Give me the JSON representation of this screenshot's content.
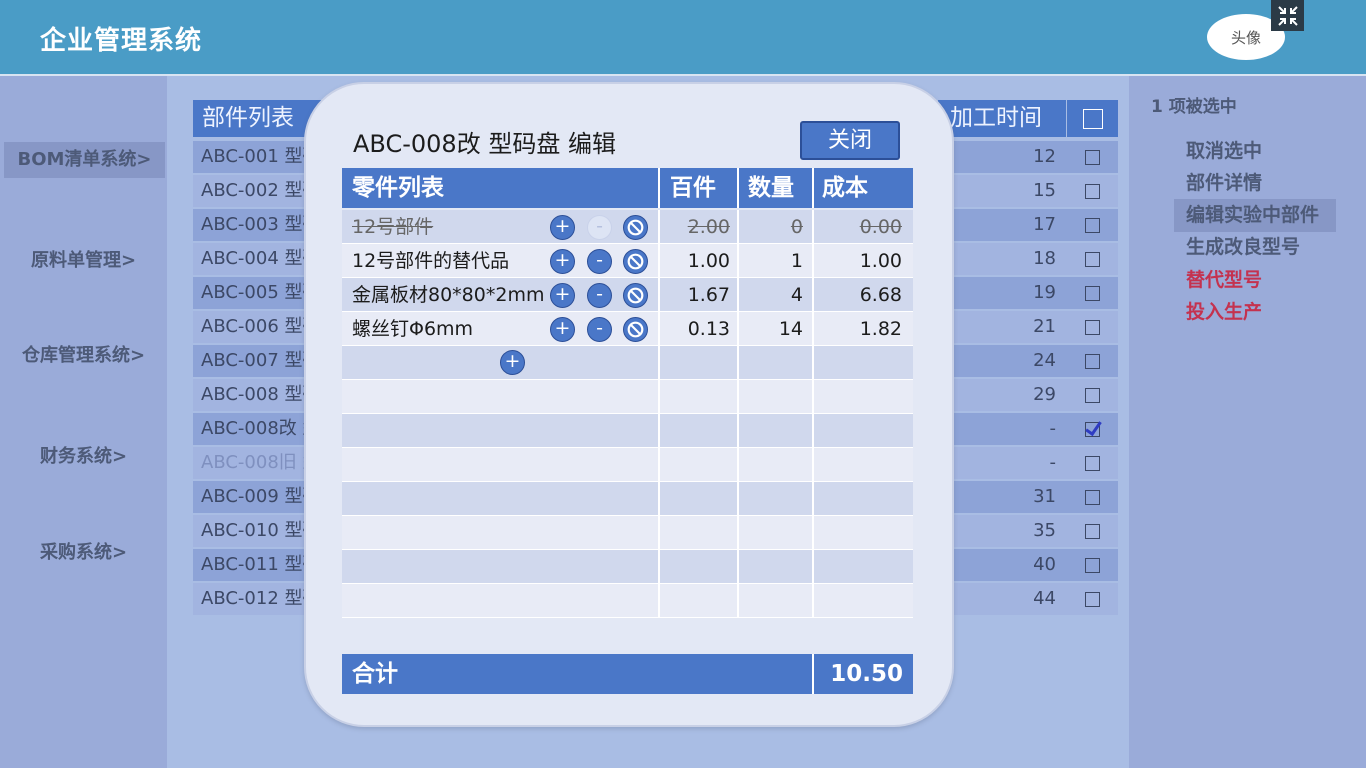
{
  "header": {
    "title": "企业管理系统",
    "avatar": "头像"
  },
  "sidebar": {
    "items": [
      {
        "label": "BOM清单系统>",
        "active": true
      },
      {
        "label": "原料单管理>"
      },
      {
        "label": "仓库管理系统>"
      },
      {
        "label": "财务系统>"
      },
      {
        "label": "采购系统>"
      }
    ]
  },
  "right_panel": {
    "selection": "1 项被选中",
    "actions": [
      {
        "label": "取消选中"
      },
      {
        "label": "部件详情"
      },
      {
        "label": "编辑实验中部件",
        "active": true
      },
      {
        "label": "生成改良型号"
      },
      {
        "label": "替代型号",
        "color": "#c4324f"
      },
      {
        "label": "投入生产",
        "color": "#c4324f"
      }
    ]
  },
  "parts_table": {
    "headers": {
      "name": "部件列表",
      "time": "加工时间"
    },
    "rows": [
      {
        "name": "ABC-001 型码盘",
        "time": "12",
        "checked": false
      },
      {
        "name": "ABC-002 型码盘",
        "time": "15",
        "checked": false
      },
      {
        "name": "ABC-003 型码盘",
        "time": "17",
        "checked": false
      },
      {
        "name": "ABC-004 型码盘",
        "time": "18",
        "checked": false
      },
      {
        "name": "ABC-005 型码盘",
        "time": "19",
        "checked": false
      },
      {
        "name": "ABC-006 型码盘",
        "time": "21",
        "checked": false
      },
      {
        "name": "ABC-007 型码盘",
        "time": "24",
        "checked": false
      },
      {
        "name": "ABC-008 型码盘",
        "time": "29",
        "checked": false
      },
      {
        "name": "ABC-008改 型码盘",
        "time": "-",
        "checked": true
      },
      {
        "name": "ABC-008旧 型码盘",
        "time": "-",
        "checked": false,
        "muted": true
      },
      {
        "name": "ABC-009 型码盘",
        "time": "31",
        "checked": false
      },
      {
        "name": "ABC-010 型码盘",
        "time": "35",
        "checked": false
      },
      {
        "name": "ABC-011 型码盘",
        "time": "40",
        "checked": false
      },
      {
        "name": "ABC-012 型码盘",
        "time": "44",
        "checked": false
      }
    ]
  },
  "modal": {
    "title": "ABC-008改 型码盘 编辑",
    "close_label": "关闭",
    "columns": {
      "parts": "零件列表",
      "unit": "百件",
      "qty": "数量",
      "cost": "成本"
    },
    "rows": [
      {
        "name": "12号部件",
        "unit": "2.00",
        "qty": "0",
        "cost": "0.00",
        "removed": true
      },
      {
        "name": "12号部件的替代品",
        "unit": "1.00",
        "qty": "1",
        "cost": "1.00"
      },
      {
        "name": "金属板材80*80*2mm",
        "unit": "1.67",
        "qty": "4",
        "cost": "6.68"
      },
      {
        "name": "螺丝钉Φ6mm",
        "unit": "0.13",
        "qty": "14",
        "cost": "1.82"
      }
    ],
    "add_icon": "plus-icon",
    "total_label": "合计",
    "total_value": "10.50"
  },
  "colors": {
    "header": "#4a9cc6",
    "accent": "#4a77c8",
    "danger": "#c4324f"
  }
}
